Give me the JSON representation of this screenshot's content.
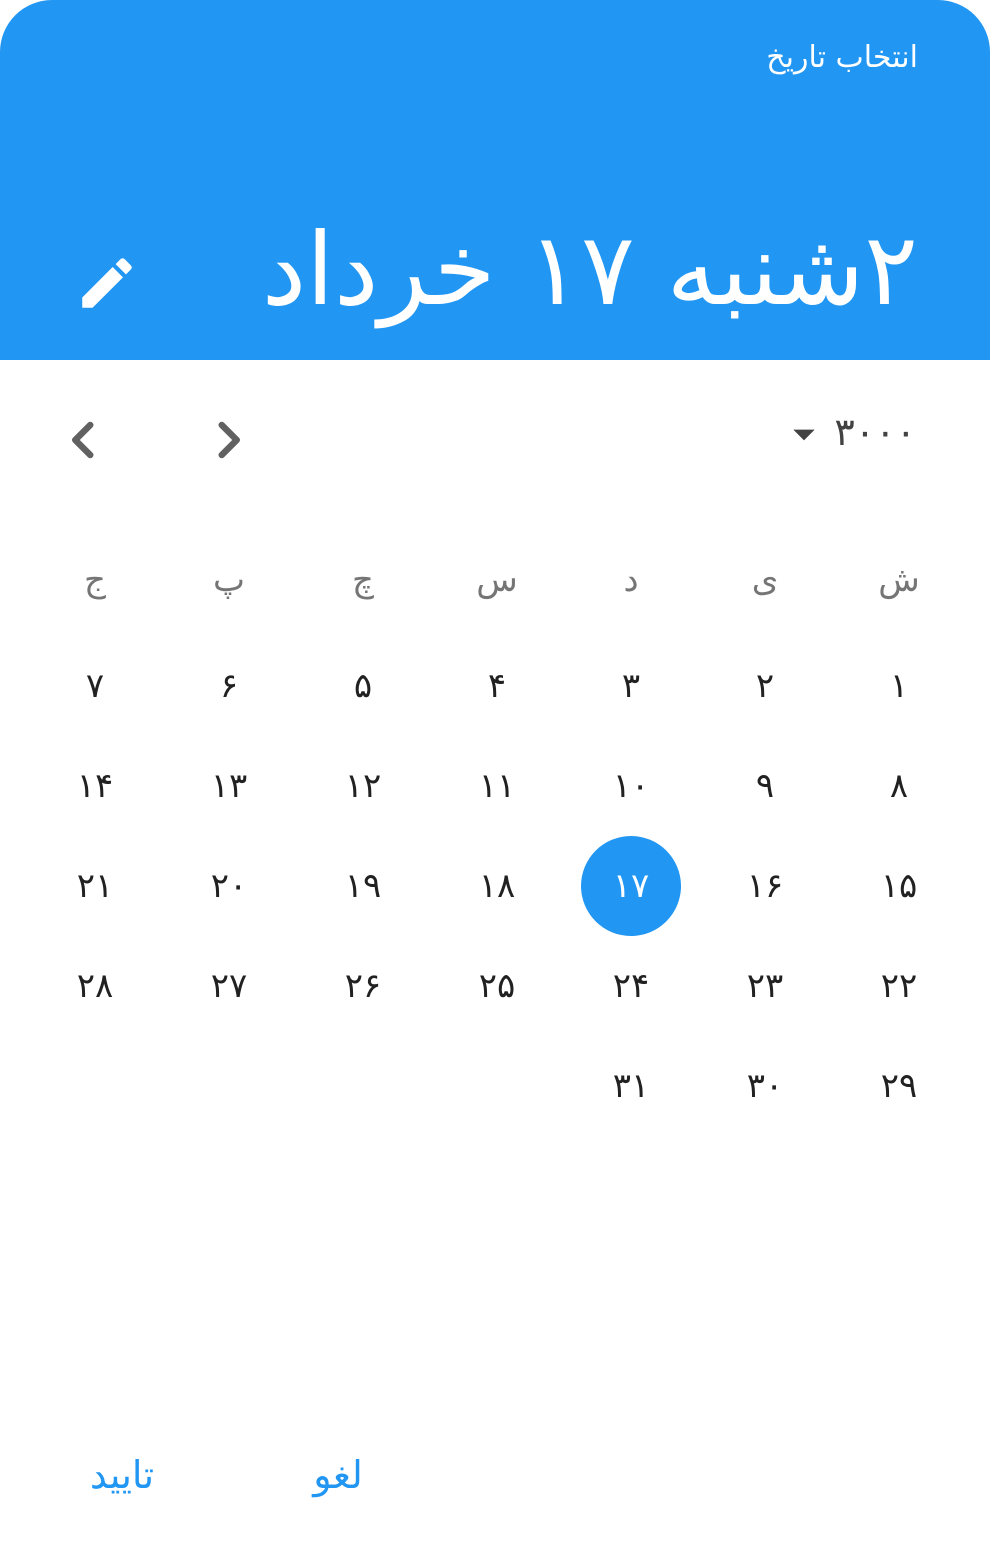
{
  "header": {
    "title": "انتخاب تاریخ",
    "selected_date": "۲شنبه ۱۷ خرداد",
    "edit_icon": "pencil-icon",
    "background": "#2196f3"
  },
  "navigation": {
    "year_label": "۳۰۰۰",
    "dropdown_icon": "arrow-drop-down-icon",
    "prev_icon": "chevron-left-icon",
    "next_icon": "chevron-right-icon"
  },
  "weekdays": [
    "ش",
    "ی",
    "د",
    "س",
    "چ",
    "پ",
    "ج"
  ],
  "weeks": [
    [
      "۱",
      "۲",
      "۳",
      "۴",
      "۵",
      "۶",
      "۷"
    ],
    [
      "۸",
      "۹",
      "۱۰",
      "۱۱",
      "۱۲",
      "۱۳",
      "۱۴"
    ],
    [
      "۱۵",
      "۱۶",
      "۱۷",
      "۱۸",
      "۱۹",
      "۲۰",
      "۲۱"
    ],
    [
      "۲۲",
      "۲۳",
      "۲۴",
      "۲۵",
      "۲۶",
      "۲۷",
      "۲۸"
    ],
    [
      "۲۹",
      "۳۰",
      "۳۱",
      "",
      "",
      "",
      ""
    ]
  ],
  "selected_day": "۱۷",
  "actions": {
    "confirm_label": "تایید",
    "cancel_label": "لغو"
  },
  "colors": {
    "accent": "#2196f3",
    "text": "#212121",
    "muted": "#757575"
  }
}
